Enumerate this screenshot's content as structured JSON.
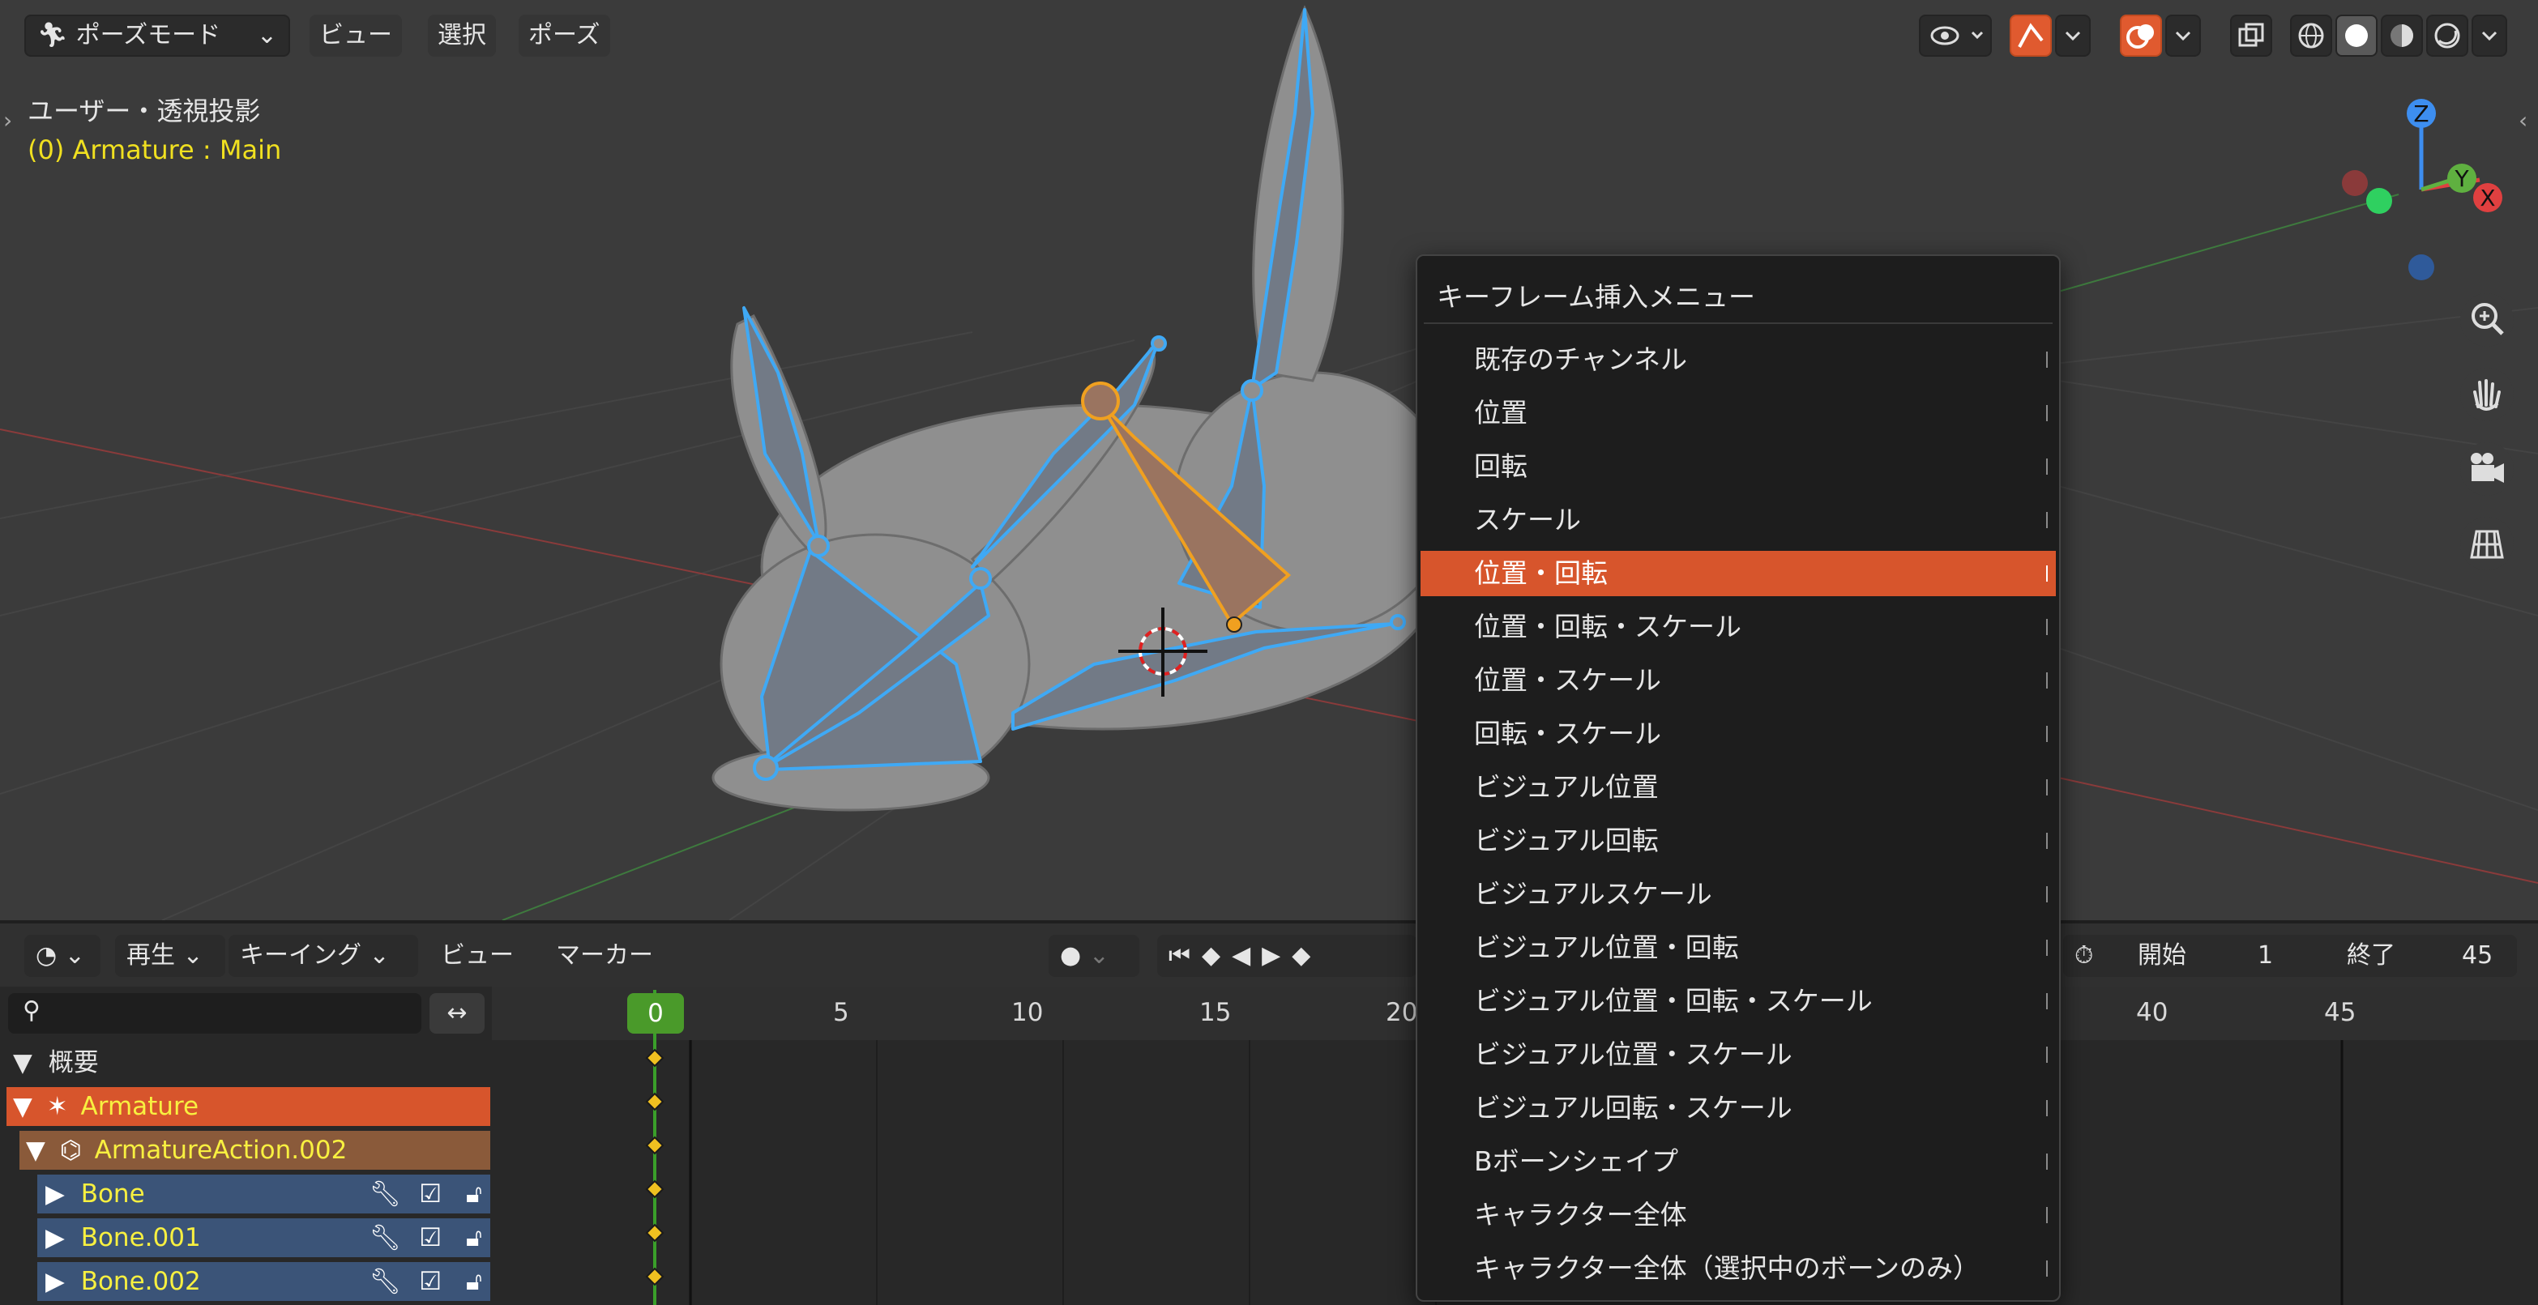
{
  "viewport": {
    "mode_label": "ポーズモード",
    "menus": [
      "ビュー",
      "選択",
      "ポーズ"
    ],
    "view_name": "ユーザー・透視投影",
    "object_info": "(0) Armature : Main",
    "axes": {
      "z": "Z",
      "y": "Y",
      "x": "X"
    }
  },
  "keyframe_menu": {
    "title": "キーフレーム挿入メニュー",
    "items": [
      "既存のチャンネル",
      "位置",
      "回転",
      "スケール",
      "位置・回転",
      "位置・回転・スケール",
      "位置・スケール",
      "回転・スケール",
      "ビジュアル位置",
      "ビジュアル回転",
      "ビジュアルスケール",
      "ビジュアル位置・回転",
      "ビジュアル位置・回転・スケール",
      "ビジュアル位置・スケール",
      "ビジュアル回転・スケール",
      "Bボーンシェイプ",
      "キャラクター全体",
      "キャラクター全体（選択中のボーンのみ）"
    ],
    "highlighted": "位置・回転"
  },
  "timeline": {
    "playback_label": "再生",
    "keying_label": "キーイング",
    "view_label": "ビュー",
    "marker_label": "マーカー",
    "start_label": "開始",
    "start_value": "1",
    "end_label": "終了",
    "end_value": "45",
    "current_frame": "0",
    "ruler_labels": [
      "5",
      "10",
      "15",
      "20",
      "40",
      "45"
    ],
    "channels": {
      "summary": "概要",
      "armature": "Armature",
      "action": "ArmatureAction.002",
      "bones": [
        "Bone",
        "Bone.001",
        "Bone.002"
      ]
    }
  },
  "colors": {
    "accent": "#e05a2f",
    "menu_highlight": "#d7552c",
    "object_text": "#f0e020",
    "frame_indicator": "#3a8f2a",
    "bone_outline": "#3fa9f5"
  }
}
